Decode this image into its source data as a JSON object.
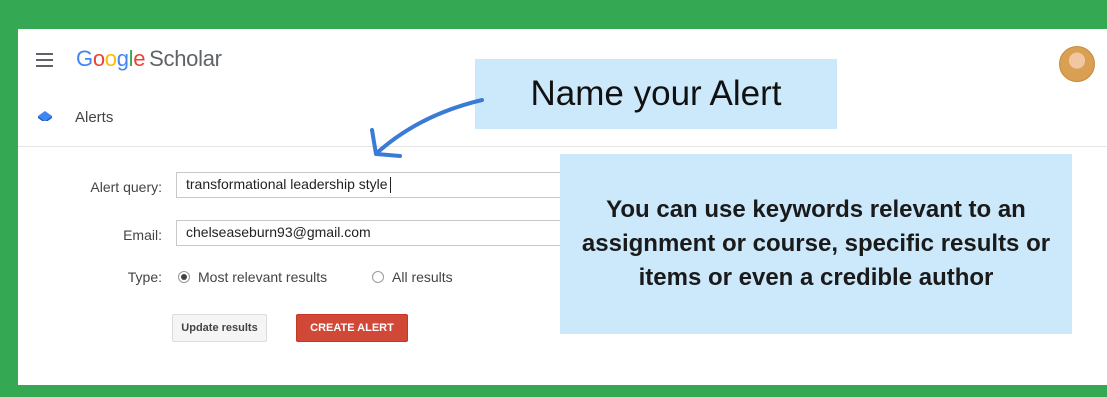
{
  "header": {
    "logo_google": [
      "G",
      "o",
      "o",
      "g",
      "l",
      "e"
    ],
    "logo_scholar": "Scholar"
  },
  "nav": {
    "alerts_label": "Alerts"
  },
  "form": {
    "query_label": "Alert query:",
    "query_value": "transformational leadership style",
    "email_label": "Email:",
    "email_value": "chelseaseburn93@gmail.com",
    "type_label": "Type:",
    "type_options": [
      "Most relevant results",
      "All results"
    ],
    "type_selected": "Most relevant results",
    "update_button": "Update results",
    "create_button": "CREATE ALERT"
  },
  "annotations": {
    "name_alert": "Name your Alert",
    "keywords_tip": "You can use keywords relevant to an assignment or course, specific results or items or even a credible author"
  },
  "colors": {
    "frame_green": "#34a853",
    "callout_blue": "#cce8fb",
    "create_red": "#d14836",
    "arrow_blue": "#3a7bd5"
  },
  "icons": {
    "menu": "hamburger-menu-icon",
    "alerts": "alerts-envelope-icon",
    "avatar": "user-avatar"
  }
}
